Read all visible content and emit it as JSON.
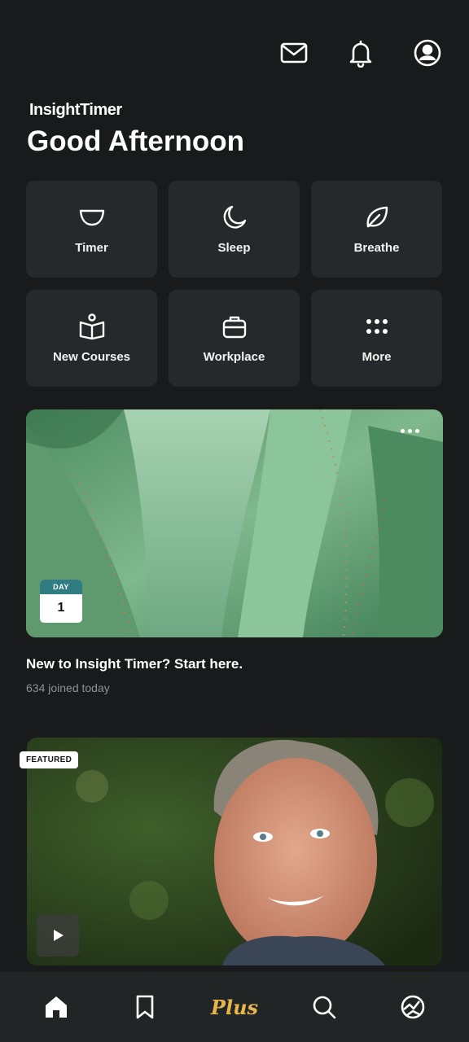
{
  "header": {
    "icons": [
      "mail-icon",
      "bell-icon",
      "profile-icon"
    ]
  },
  "brand": "InsightTimer",
  "greeting": "Good Afternoon",
  "categories": [
    {
      "label": "Timer",
      "icon": "bowl-icon"
    },
    {
      "label": "Sleep",
      "icon": "moon-icon"
    },
    {
      "label": "Breathe",
      "icon": "leaf-icon"
    },
    {
      "label": "New Courses",
      "icon": "book-icon"
    },
    {
      "label": "Workplace",
      "icon": "briefcase-icon"
    },
    {
      "label": "More",
      "icon": "grid-dots-icon"
    }
  ],
  "course_card": {
    "badge_top": "DAY",
    "badge_num": "1",
    "title": "New to Insight Timer? Start here.",
    "subtitle": "634 joined today"
  },
  "featured_card": {
    "badge": "FEATURED"
  },
  "tabbar": {
    "plus_label": "Plus",
    "items": [
      "home-icon",
      "bookmark-icon",
      "plus-tab",
      "search-icon",
      "explore-icon"
    ],
    "active": "home"
  }
}
